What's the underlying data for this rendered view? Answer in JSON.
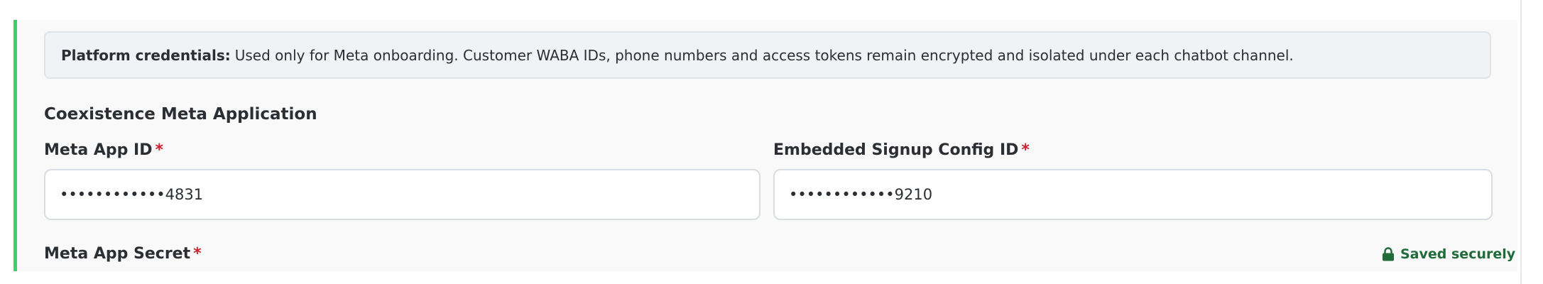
{
  "notice": {
    "label": "Platform credentials:",
    "text": "Used only for Meta onboarding. Customer WABA IDs, phone numbers and access tokens remain encrypted and isolated under each chatbot channel."
  },
  "section": {
    "title": "Coexistence Meta Application"
  },
  "fields": {
    "meta_app_id": {
      "label": "Meta App ID",
      "required": "*",
      "value": "••••••••••••4831"
    },
    "embedded_signup_config_id": {
      "label": "Embedded Signup Config ID",
      "required": "*",
      "value": "••••••••••••9210"
    },
    "meta_app_secret": {
      "label": "Meta App Secret",
      "required": "*",
      "status": "Saved securely"
    }
  },
  "icons": {
    "saved_status": "lock-icon"
  },
  "colors": {
    "accent_border": "#3ccf6c",
    "required": "#d01f2e",
    "saved": "#1f6b3a"
  }
}
